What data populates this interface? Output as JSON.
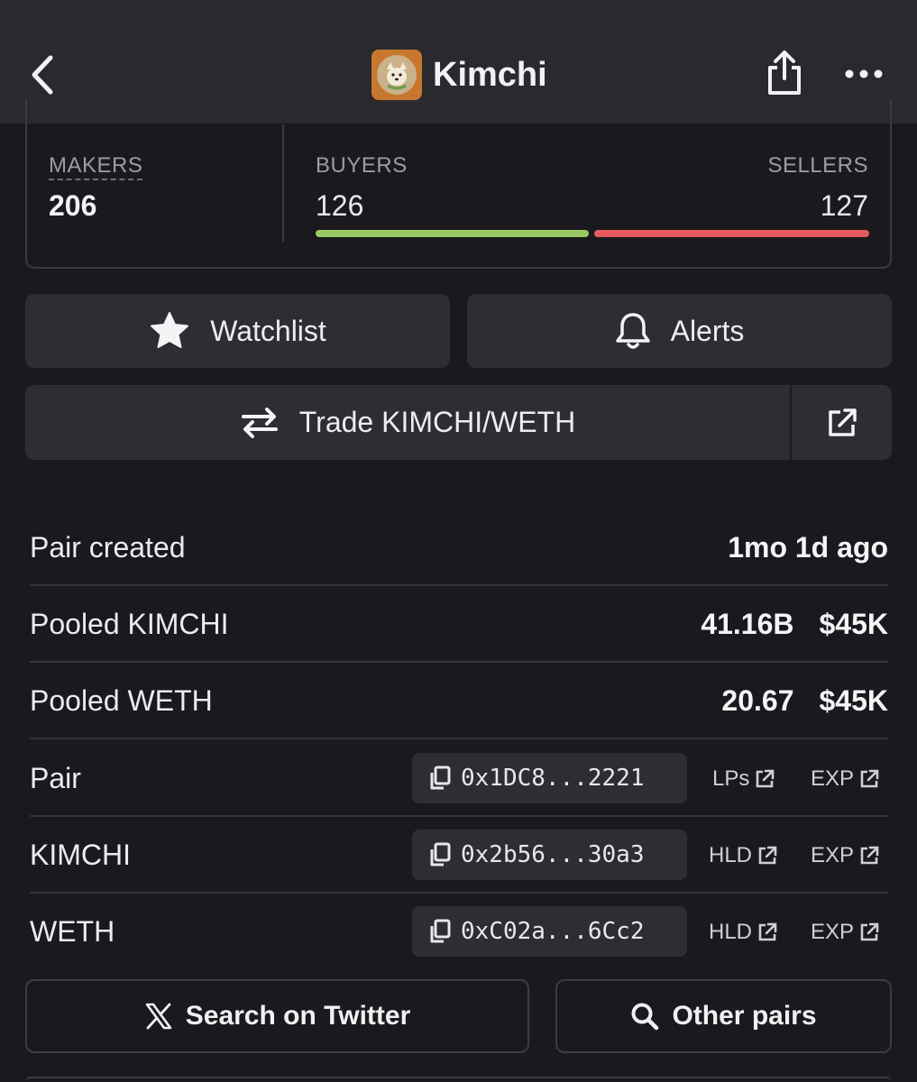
{
  "header": {
    "title": "Kimchi",
    "icons": [
      "back-icon",
      "token-logo",
      "share-icon",
      "more-icon"
    ]
  },
  "stats": {
    "makers_label": "MAKERS",
    "makers_value": "206",
    "buyers_label": "BUYERS",
    "buyers_value": "126",
    "sellers_label": "SELLERS",
    "sellers_value": "127",
    "buyers_fraction": 0.498,
    "colors": {
      "buy": "#9ac964",
      "sell": "#e65a5e"
    }
  },
  "actions": {
    "watchlist_label": "Watchlist",
    "alerts_label": "Alerts",
    "trade_label": "Trade KIMCHI/WETH"
  },
  "info": {
    "pair_created_label": "Pair created",
    "pair_created_value": "1mo 1d ago",
    "pooled_kimchi_label": "Pooled KIMCHI",
    "pooled_kimchi_amount": "41.16B",
    "pooled_kimchi_usd": "$45K",
    "pooled_weth_label": "Pooled WETH",
    "pooled_weth_amount": "20.67",
    "pooled_weth_usd": "$45K"
  },
  "addresses": [
    {
      "label": "Pair",
      "address": "0x1DC8...2221",
      "link1": "LPs",
      "link2": "EXP"
    },
    {
      "label": "KIMCHI",
      "address": "0x2b56...30a3",
      "link1": "HLD",
      "link2": "EXP"
    },
    {
      "label": "WETH",
      "address": "0xC02a...6Cc2",
      "link1": "HLD",
      "link2": "EXP"
    }
  ],
  "footer": {
    "twitter_label": "Search on Twitter",
    "other_pairs_label": "Other pairs"
  }
}
